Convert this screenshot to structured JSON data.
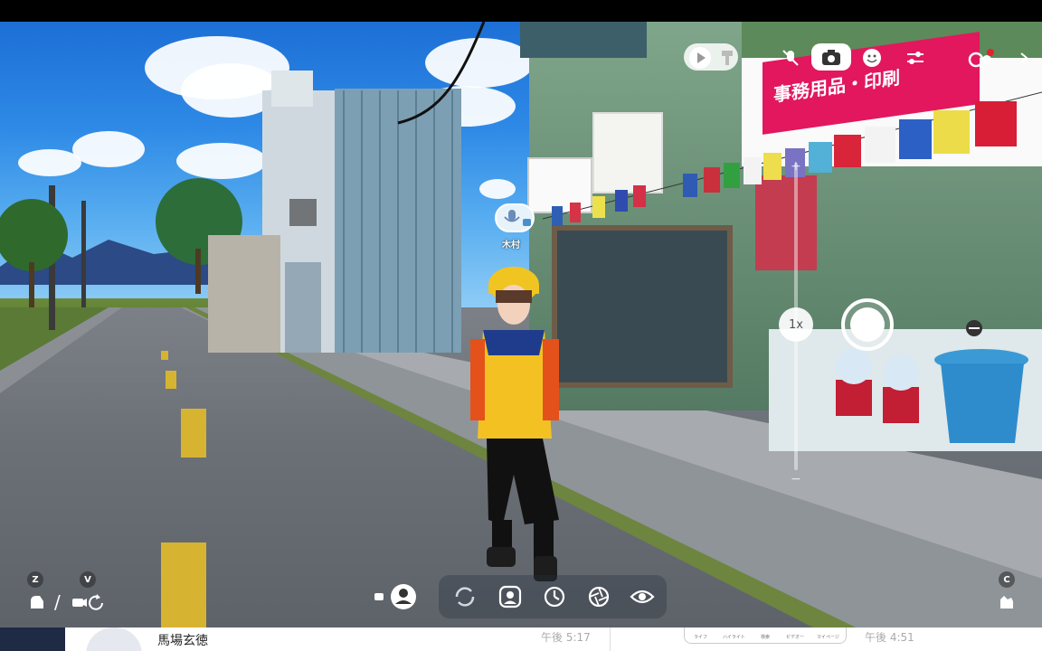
{
  "player": {
    "name": "木村"
  },
  "storefront": {
    "banner_text": "事務用品・印刷"
  },
  "camera": {
    "zoom_label": "1x",
    "zoom_plus": "+",
    "zoom_minus": "−"
  },
  "hotkeys": {
    "left_1": "Z",
    "left_2": "V",
    "right_1": "C",
    "separator": "/"
  },
  "top_controls": [
    {
      "id": "play",
      "icon": "play-icon"
    },
    {
      "id": "brush",
      "icon": "brush-icon"
    },
    {
      "id": "mic-off",
      "icon": "mic-off-icon"
    },
    {
      "id": "camera",
      "icon": "camera-icon"
    },
    {
      "id": "emote",
      "icon": "smiley-icon"
    },
    {
      "id": "settings",
      "icon": "sliders-icon"
    },
    {
      "id": "record",
      "icon": "record-icon"
    },
    {
      "id": "more",
      "icon": "chevron-right-icon"
    }
  ],
  "toolbar": [
    {
      "id": "person-mode",
      "icon": "person-icon"
    },
    {
      "id": "rotate",
      "icon": "rotate-icon"
    },
    {
      "id": "face",
      "icon": "face-icon"
    },
    {
      "id": "timer",
      "icon": "timer-icon"
    },
    {
      "id": "shutter-mode",
      "icon": "aperture-icon"
    },
    {
      "id": "visibility",
      "icon": "eye-icon"
    }
  ],
  "bottom_strip": {
    "name": "馬場玄徳",
    "time_1": "午後 5:17",
    "time_2": "午後 4:51",
    "tabs": [
      "ライフ",
      "ハイライト",
      "検索",
      "ビデオー",
      "マイページ"
    ]
  },
  "colors": {
    "accent_pink": "#e2175e",
    "hud_white": "#ffffff",
    "record_red": "#e0242e"
  }
}
